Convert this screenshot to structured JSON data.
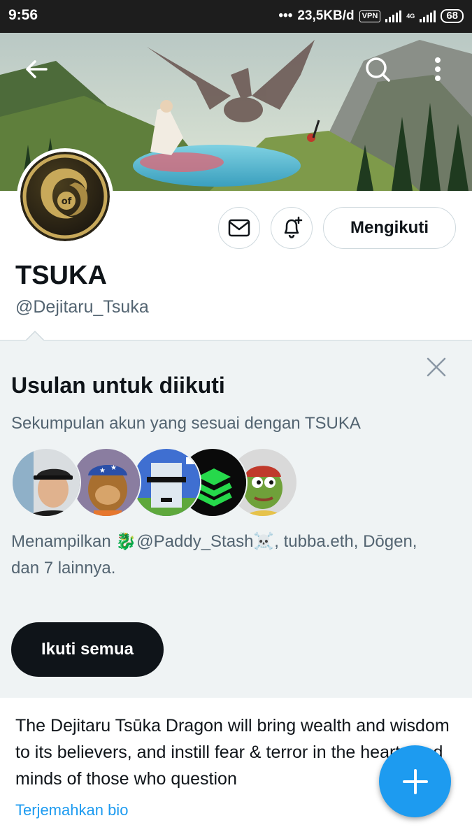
{
  "statusbar": {
    "time": "9:56",
    "speed": "23,5KB/d",
    "vpn": "VPN",
    "network": "4G",
    "battery": "68"
  },
  "banner": {
    "image": "dragon-fantasy-landscape",
    "back_icon": "arrow-left-icon",
    "search_icon": "search-icon",
    "more_icon": "more-vertical-icon"
  },
  "profile": {
    "avatar": "tsuka-dragon-coin-logo",
    "name": "TSUKA",
    "handle": "@Dejitaru_Tsuka",
    "message_icon": "envelope-icon",
    "notify_icon": "bell-plus-icon",
    "follow_label": "Mengikuti"
  },
  "suggestions": {
    "title": "Usulan untuk diikuti",
    "subtitle": "Sekumpulan akun yang sesuai dengan TSUKA",
    "description": "Menampilkan 🐉@Paddy_Stash☠️, tubba.eth, Dōgen, dan 7 lainnya.",
    "follow_all_label": "Ikuti semua",
    "avatars": [
      "man-in-cap-avatar",
      "bored-ape-avatar",
      "pixel-punk-avatar",
      "green-stack-logo-avatar",
      "pepe-frog-avatar"
    ]
  },
  "bio": {
    "text": "The Dejitaru Tsūka Dragon will bring wealth and wisdom to its believers, and instill fear & terror in the hearts and minds of those who question",
    "translate_label": "Terjemahkan bio"
  },
  "colors": {
    "accent": "#1d9bf0",
    "text": "#0f1419",
    "muted": "#536471",
    "panel": "#eff3f4"
  }
}
